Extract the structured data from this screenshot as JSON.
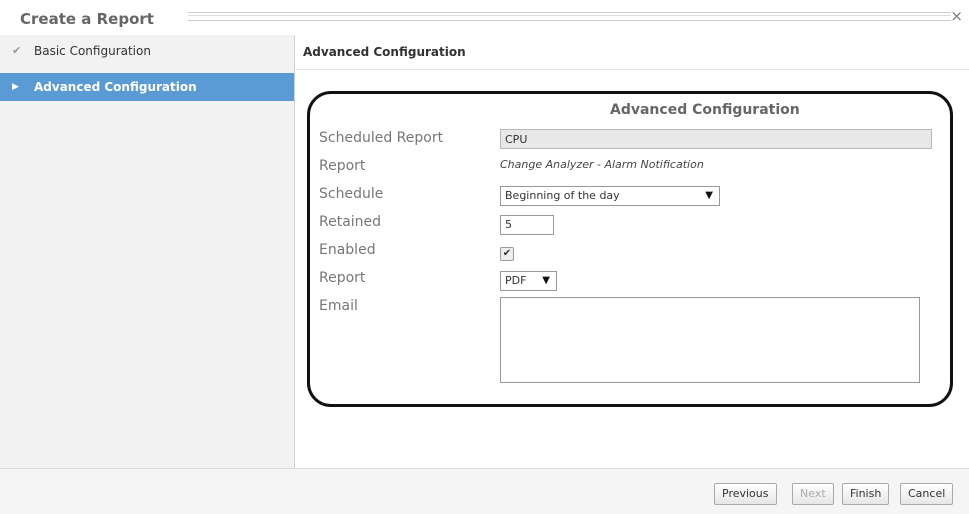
{
  "window": {
    "title": "Create a Report",
    "close_glyph": "×"
  },
  "sidebar": {
    "items": [
      {
        "label": "Basic Configuration",
        "icon": "checkmark-icon",
        "icon_glyph": "✔",
        "state": "done"
      },
      {
        "label": "Advanced Configuration",
        "icon": "arrow-right-icon",
        "icon_glyph": "▶",
        "state": "active"
      }
    ]
  },
  "main": {
    "header": "Advanced Configuration",
    "panel": {
      "title": "Advanced Configuration",
      "fields": {
        "scheduled_report": {
          "label": "Scheduled Report",
          "value": "CPU"
        },
        "report_name": {
          "label": "Report",
          "value": "Change Analyzer - Alarm Notification"
        },
        "schedule": {
          "label": "Schedule",
          "value": "Beginning of the day"
        },
        "retained": {
          "label": "Retained",
          "value": "5"
        },
        "enabled": {
          "label": "Enabled",
          "checked": true,
          "glyph": "✔"
        },
        "report_format": {
          "label": "Report",
          "value": "PDF"
        },
        "email": {
          "label": "Email",
          "value": ""
        }
      }
    }
  },
  "footer": {
    "previous": "Previous",
    "next": "Next",
    "finish": "Finish",
    "cancel": "Cancel"
  },
  "colors": {
    "accent": "#5b9bd5",
    "sidebar_bg": "#f2f2f2"
  }
}
